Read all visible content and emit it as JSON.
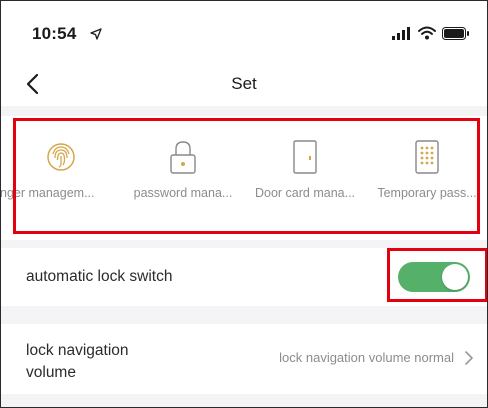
{
  "status_bar": {
    "time": "10:54"
  },
  "nav": {
    "title": "Set"
  },
  "features": [
    {
      "label": "fingerprint management",
      "display": "nger managem...",
      "icon": "fingerprint-icon"
    },
    {
      "label": "password management",
      "display": "password mana...",
      "icon": "lock-icon"
    },
    {
      "label": "Door card management",
      "display": "Door card mana...",
      "icon": "door-card-icon"
    },
    {
      "label": "Temporary password",
      "display": "Temporary pass...",
      "icon": "keypad-icon"
    }
  ],
  "auto_lock": {
    "label": "automatic lock switch",
    "enabled": true
  },
  "navigation_volume": {
    "label": "lock navigation volume",
    "value": "lock navigation volume normal"
  },
  "colors": {
    "accent_toggle": "#55b06a",
    "highlight_box": "#e3000f",
    "icon_gold": "#d6a74a"
  }
}
